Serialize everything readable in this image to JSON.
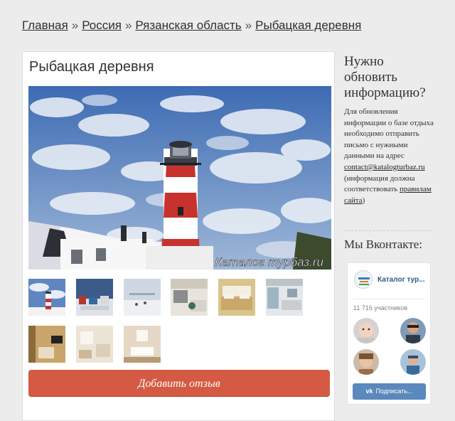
{
  "breadcrumb": {
    "items": [
      "Главная",
      "Россия",
      "Рязанская область",
      "Рыбацкая деревня"
    ],
    "separator": "»"
  },
  "main": {
    "title": "Рыбацкая деревня",
    "watermark": "Каталог турбаз.ru",
    "thumbnails": [
      "lighthouse-photo-icon",
      "houses-photo-icon",
      "snow-photo-icon",
      "kitchen-photo-icon",
      "bedroom-photo-icon",
      "kitchen2-photo-icon",
      "room-tv-photo-icon",
      "room-photo-icon",
      "bathroom-photo-icon"
    ],
    "review_button": "Добавить отзыв"
  },
  "sidebar": {
    "update_title": "Нужно обновить информацию?",
    "update_text_1": "Для обновления информации о базе отдыха необходимо отправить письмо с нужными данными на адрес",
    "email": "contact@katalogturbaz.ru",
    "update_text_2": "(информация должна соответствовать",
    "rules_link": "правилам сайта",
    "update_text_3": ")",
    "vk_title": "Мы Вконтакте:",
    "vk_widget": {
      "group_name": "Каталог тур...",
      "members": "11 716 участников",
      "subscribe": "Подписать..."
    }
  },
  "colors": {
    "accent": "#d55a43",
    "vk_blue": "#5b88bd",
    "vk_link": "#2a5885"
  }
}
